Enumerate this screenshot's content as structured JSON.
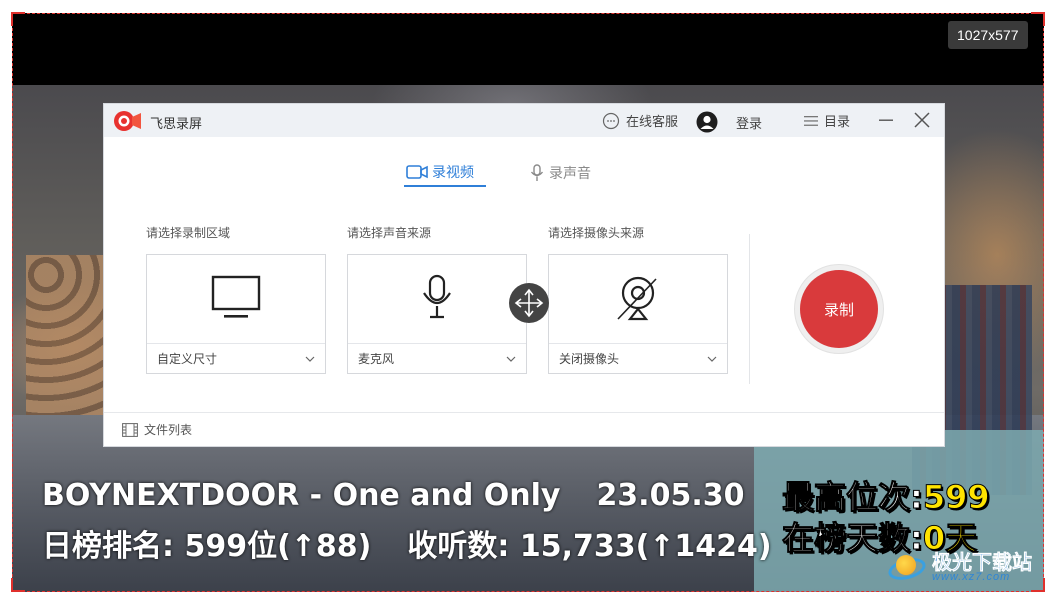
{
  "overlay": {
    "dimensions": "1027x577"
  },
  "captions": {
    "line1_title": "BOYNEXTDOOR - One and Only",
    "line1_date": "23.05.30",
    "line2_rank": "日榜排名: 599位(↑88)",
    "line2_listen": "收听数: 15,733(↑1424)",
    "best_rank_label": "最高位次:",
    "best_rank_value": "599",
    "days_label": "在榜天数:",
    "days_value": "0天"
  },
  "watermark": {
    "title": "极光下载站",
    "url": "www.xz7.com"
  },
  "app": {
    "title": "飞思录屏",
    "titlebar": {
      "service": "在线客服",
      "login": "登录",
      "menu": "目录"
    },
    "tabs": [
      {
        "label": "录视频",
        "active": true
      },
      {
        "label": "录声音",
        "active": false
      }
    ],
    "sections": {
      "area": {
        "label": "请选择录制区域",
        "value": "自定义尺寸"
      },
      "sound": {
        "label": "请选择声音来源",
        "value": "麦克风"
      },
      "camera": {
        "label": "请选择摄像头来源",
        "value": "关闭摄像头"
      }
    },
    "record_button": "录制",
    "footer": {
      "file_list": "文件列表"
    }
  },
  "colors": {
    "accent_blue": "#2f7fd8",
    "record_red": "#d93a3c",
    "caption_yellow": "#ffe400",
    "selection_border": "#e0302c"
  }
}
